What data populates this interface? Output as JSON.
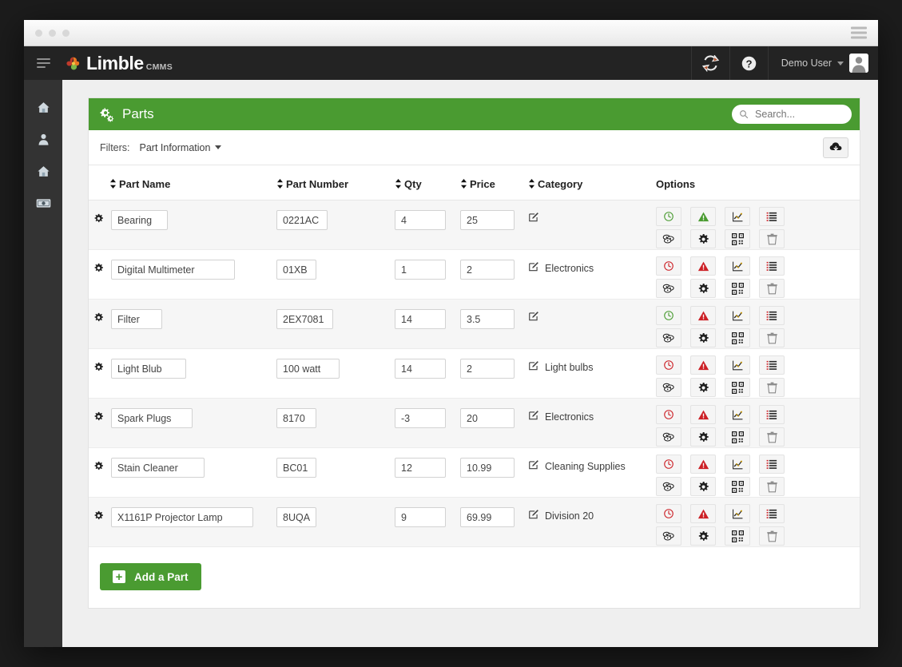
{
  "browser": {
    "dots": [
      "dot-1",
      "dot-2",
      "dot-3"
    ],
    "menu_icon": "hamburger-icon"
  },
  "topbar": {
    "menu_icon": "hamburger-icon",
    "brand": "Limble",
    "brand_sub": "CMMS",
    "refresh_icon": "refresh-icon",
    "help_icon": "help-circle-icon",
    "user_name": "Demo User",
    "caret_icon": "caret-down-icon",
    "avatar_icon": "user-avatar-icon"
  },
  "sidebar": {
    "items": [
      {
        "name": "sidebar-item-home",
        "icon": "home-icon"
      },
      {
        "name": "sidebar-item-users",
        "icon": "user-icon"
      },
      {
        "name": "sidebar-item-assets",
        "icon": "home-icon"
      },
      {
        "name": "sidebar-item-parts",
        "icon": "money-bill-icon"
      }
    ]
  },
  "panel": {
    "icon": "gears-icon",
    "title": "Parts",
    "search": {
      "icon": "search-icon",
      "placeholder": "Search..."
    }
  },
  "filters": {
    "label": "Filters:",
    "dropdown": "Part Information",
    "dropdown_icon": "caret-down-icon",
    "download_icon": "cloud-download-icon"
  },
  "table": {
    "columns": [
      {
        "label": "Part Name",
        "sortable": true
      },
      {
        "label": "Part Number",
        "sortable": true
      },
      {
        "label": "Qty",
        "sortable": true
      },
      {
        "label": "Price",
        "sortable": true
      },
      {
        "label": "Category",
        "sortable": true
      },
      {
        "label": "Options",
        "sortable": false
      }
    ],
    "option_icons": [
      "clock-icon",
      "warning-triangle-icon",
      "chart-line-icon",
      "list-icon",
      "coins-icon",
      "gear-icon",
      "qr-code-icon",
      "trash-icon"
    ],
    "rows": [
      {
        "gear_icon": "gear-icon",
        "name": "Bearing",
        "number": "0221AC",
        "qty": "4",
        "price": "25",
        "category_icon": "edit-icon",
        "category": "",
        "clock_state": "green",
        "warn_state": "green"
      },
      {
        "gear_icon": "gear-icon",
        "name": "Digital Multimeter",
        "number": "01XB",
        "qty": "1",
        "price": "2",
        "category_icon": "edit-icon",
        "category": "Electronics",
        "clock_state": "red",
        "warn_state": "red"
      },
      {
        "gear_icon": "gear-icon",
        "name": "Filter",
        "number": "2EX7081",
        "qty": "14",
        "price": "3.5",
        "category_icon": "edit-icon",
        "category": "",
        "clock_state": "green",
        "warn_state": "red"
      },
      {
        "gear_icon": "gear-icon",
        "name": "Light Blub",
        "number": "100 watt",
        "qty": "14",
        "price": "2",
        "category_icon": "edit-icon",
        "category": "Light bulbs",
        "clock_state": "red",
        "warn_state": "red"
      },
      {
        "gear_icon": "gear-icon",
        "name": "Spark Plugs",
        "number": "8170",
        "qty": "-3",
        "price": "20",
        "category_icon": "edit-icon",
        "category": "Electronics",
        "clock_state": "red",
        "warn_state": "red"
      },
      {
        "gear_icon": "gear-icon",
        "name": "Stain Cleaner",
        "number": "BC01",
        "qty": "12",
        "price": "10.99",
        "category_icon": "edit-icon",
        "category": "Cleaning Supplies",
        "clock_state": "red",
        "warn_state": "red"
      },
      {
        "gear_icon": "gear-icon",
        "name": "X1161P Projector Lamp",
        "number": "8UQA",
        "qty": "9",
        "price": "69.99",
        "category_icon": "edit-icon",
        "category": "Division 20",
        "clock_state": "red",
        "warn_state": "red"
      }
    ]
  },
  "footer": {
    "add_label": "Add a Part",
    "add_icon": "plus-square-icon"
  },
  "colors": {
    "brand_green": "#4a9b31",
    "topbar_dark": "#232323",
    "sidebar_dark": "#333333",
    "state_green": "#4a9b31",
    "state_red": "#cc2026",
    "page_bg": "#efefef"
  }
}
